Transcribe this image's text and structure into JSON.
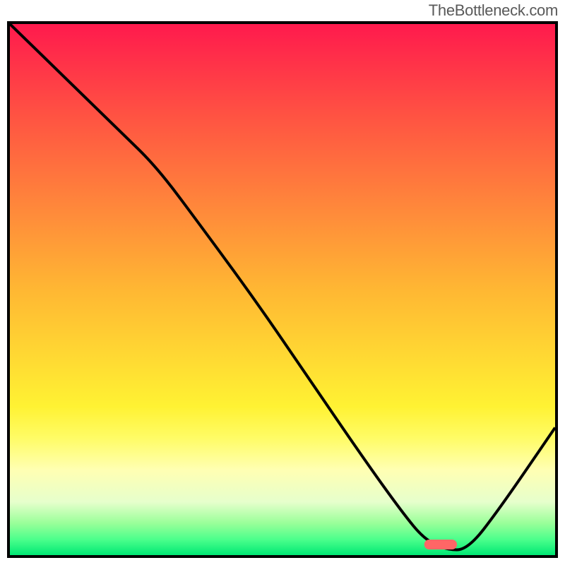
{
  "watermark": "TheBottleneck.com",
  "chart_data": {
    "type": "line",
    "title": "",
    "xlabel": "",
    "ylabel": "",
    "xlim": [
      0,
      100
    ],
    "ylim": [
      0,
      100
    ],
    "grid": false,
    "legend": false,
    "annotations": [],
    "background_gradient": {
      "stops": [
        {
          "pos": 0,
          "color": "#ff1a4d"
        },
        {
          "pos": 18,
          "color": "#ff5542"
        },
        {
          "pos": 36,
          "color": "#ff8c3a"
        },
        {
          "pos": 50,
          "color": "#ffb733"
        },
        {
          "pos": 62,
          "color": "#ffd733"
        },
        {
          "pos": 72,
          "color": "#fff233"
        },
        {
          "pos": 78,
          "color": "#fffc66"
        },
        {
          "pos": 84,
          "color": "#ffffb3"
        },
        {
          "pos": 90,
          "color": "#e6ffcc"
        },
        {
          "pos": 94,
          "color": "#99ff99"
        },
        {
          "pos": 97,
          "color": "#4dff8c"
        },
        {
          "pos": 100,
          "color": "#00e874"
        }
      ]
    },
    "series": [
      {
        "name": "bottleneck-curve",
        "x": [
          0,
          10,
          20,
          27,
          35,
          45,
          55,
          65,
          72,
          76,
          80,
          84,
          90,
          100
        ],
        "y": [
          100,
          90,
          80,
          73,
          62,
          48,
          33,
          18,
          8,
          3,
          1,
          1,
          9,
          24
        ]
      }
    ],
    "marker": {
      "name": "optimal-zone",
      "shape": "capsule",
      "x_center": 79,
      "y": 2,
      "width_pct": 6,
      "color": "#ff6666"
    }
  }
}
